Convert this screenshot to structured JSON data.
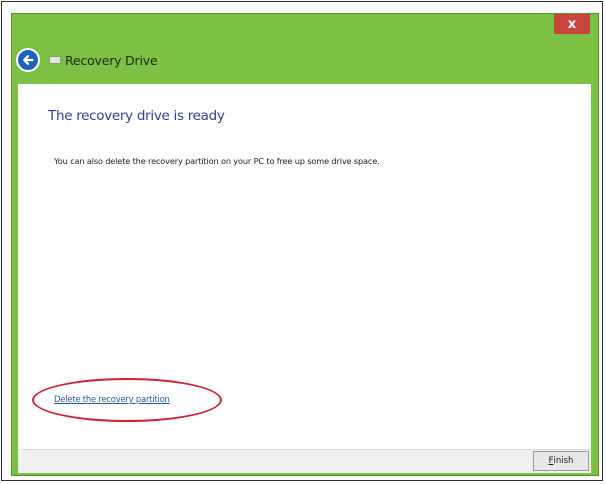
{
  "window": {
    "title": "Recovery Drive",
    "close_label": "x",
    "colors": {
      "title_bar": "#7cc044",
      "close": "#c9463c",
      "back": "#1f63b9"
    }
  },
  "icons": {
    "back": "back-arrow-icon",
    "drive": "recovery-drive-icon"
  },
  "main": {
    "heading": "The recovery drive is ready",
    "message": "You can also delete the recovery partition on your PC to free up some drive space.",
    "delete_link": "Delete the recovery partition"
  },
  "footer": {
    "finish_mnemonic": "F",
    "finish_rest": "inish"
  }
}
